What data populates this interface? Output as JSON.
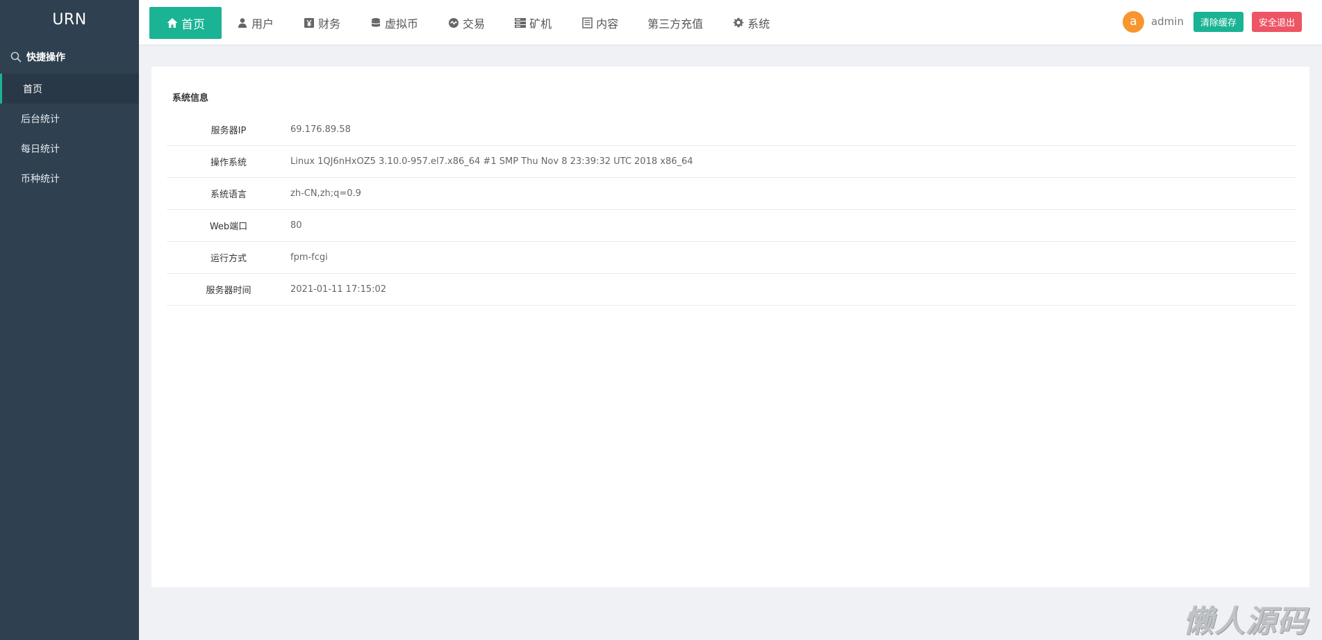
{
  "brand": "URN",
  "sidebar": {
    "quick_label": "快捷操作",
    "items": [
      {
        "label": "首页"
      },
      {
        "label": "后台统计"
      },
      {
        "label": "每日统计"
      },
      {
        "label": "币种统计"
      }
    ]
  },
  "nav": {
    "items": [
      {
        "label": "首页",
        "icon": "home-icon"
      },
      {
        "label": "用户",
        "icon": "user-icon"
      },
      {
        "label": "财务",
        "icon": "yen-icon"
      },
      {
        "label": "虚拟币",
        "icon": "database-icon"
      },
      {
        "label": "交易",
        "icon": "exchange-icon"
      },
      {
        "label": "矿机",
        "icon": "server-icon"
      },
      {
        "label": "内容",
        "icon": "document-icon"
      },
      {
        "label": "第三方充值",
        "icon": ""
      },
      {
        "label": "系统",
        "icon": "gear-icon"
      }
    ]
  },
  "user": {
    "avatar_letter": "a",
    "name": "admin",
    "clear_cache_label": "清除缓存",
    "logout_label": "安全退出"
  },
  "panel": {
    "title": "系统信息",
    "rows": [
      {
        "label": "服务器IP",
        "value": "69.176.89.58"
      },
      {
        "label": "操作系统",
        "value": "Linux 1QJ6nHxOZ5 3.10.0-957.el7.x86_64 #1 SMP Thu Nov 8 23:39:32 UTC 2018 x86_64"
      },
      {
        "label": "系统语言",
        "value": "zh-CN,zh;q=0.9"
      },
      {
        "label": "Web端口",
        "value": "80"
      },
      {
        "label": "运行方式",
        "value": "fpm-fcgi"
      },
      {
        "label": "服务器时间",
        "value": "2021-01-11 17:15:02"
      }
    ]
  },
  "watermark": "懒人源码",
  "colors": {
    "sidebar_bg": "#2f4050",
    "accent": "#1ab394",
    "danger": "#ed5565",
    "avatar": "#f7962f"
  }
}
